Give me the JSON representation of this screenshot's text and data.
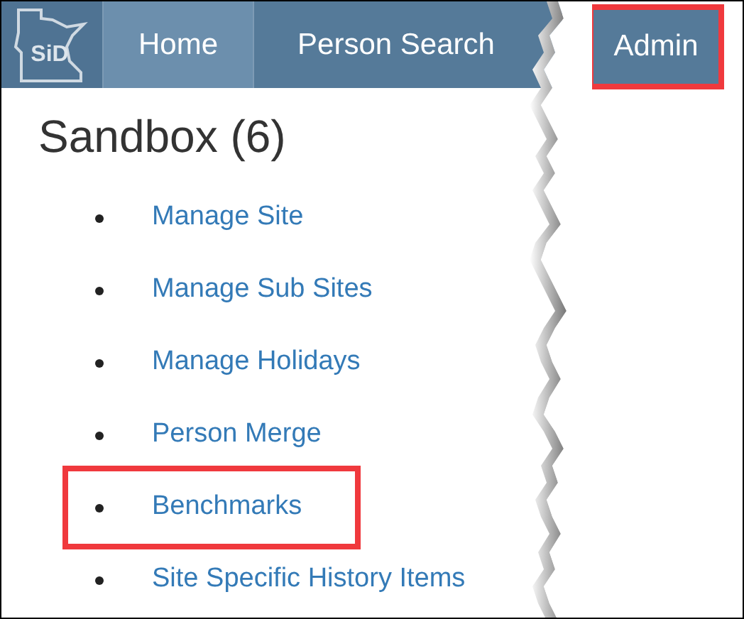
{
  "logo": {
    "text": "SiD"
  },
  "nav": [
    {
      "label": "Home",
      "selected": true
    },
    {
      "label": "Person Search",
      "selected": false
    }
  ],
  "admin_tab": {
    "label": "Admin",
    "highlighted": true
  },
  "heading": "Sandbox (6)",
  "links": [
    {
      "label": "Manage Site",
      "highlighted": false
    },
    {
      "label": "Manage Sub Sites",
      "highlighted": false
    },
    {
      "label": "Manage Holidays",
      "highlighted": false
    },
    {
      "label": "Person Merge",
      "highlighted": false
    },
    {
      "label": "Benchmarks",
      "highlighted": true
    },
    {
      "label": "Site Specific History Items",
      "highlighted": false
    }
  ]
}
